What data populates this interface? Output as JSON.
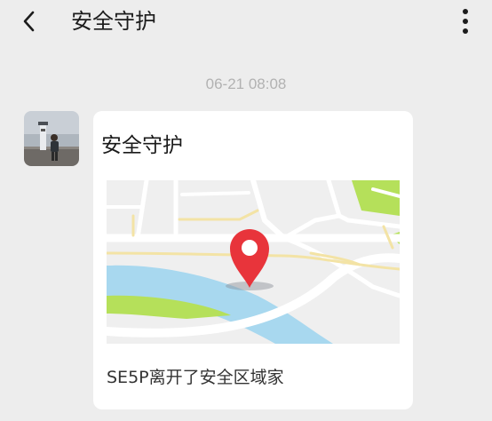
{
  "header": {
    "title": "安全守护",
    "back_icon": "chevron-left-icon",
    "more_icon": "more-vertical-icon"
  },
  "chat": {
    "timestamp": "06-21 08:08",
    "message": {
      "title": "安全守护",
      "description": "SE5P离开了安全区域家",
      "map_pin_icon": "location-pin-icon"
    }
  },
  "colors": {
    "background": "#ededed",
    "card": "#ffffff",
    "pin": "#e8343b",
    "water": "#a8d8ef",
    "park": "#b5e05a",
    "road_major": "#f3e3a5"
  }
}
